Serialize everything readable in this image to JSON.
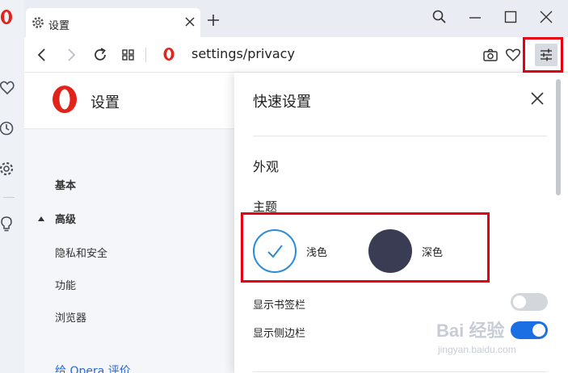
{
  "tab": {
    "title": "设置"
  },
  "address_bar": {
    "url": "settings/privacy"
  },
  "settings": {
    "title": "设置",
    "nav": {
      "basic": "基本",
      "advanced": "高级",
      "privacy": "隐私和安全",
      "features": "功能",
      "browser": "浏览器",
      "rate_opera": "给 Opera 评价"
    }
  },
  "easy_setup": {
    "title": "快速设置",
    "appearance": "外观",
    "theme_label": "主题",
    "themes": [
      {
        "label": "浅色",
        "selected": true
      },
      {
        "label": "深色",
        "selected": false
      }
    ],
    "toggles": [
      {
        "label": "显示书签栏",
        "on": false
      },
      {
        "label": "显示侧边栏",
        "on": true
      }
    ]
  },
  "watermark": {
    "logo_text": "Bai 经验",
    "url": "jingyan.baidu.com"
  },
  "colors": {
    "opera_red": "#e2231a",
    "highlight": "#e60012",
    "toggle_on": "#1c6fe3",
    "theme_dark": "#393c52",
    "link": "#2a69d6"
  },
  "icons": [
    "opera-logo-icon",
    "heart-icon",
    "history-clock-icon",
    "gear-icon",
    "lightbulb-icon",
    "search-icon",
    "minimize-icon",
    "maximize-icon",
    "close-icon",
    "back-arrow-icon",
    "forward-arrow-icon",
    "reload-icon",
    "tab-grid-icon",
    "camera-icon",
    "easy-setup-sliders-icon",
    "checkmark-icon"
  ]
}
